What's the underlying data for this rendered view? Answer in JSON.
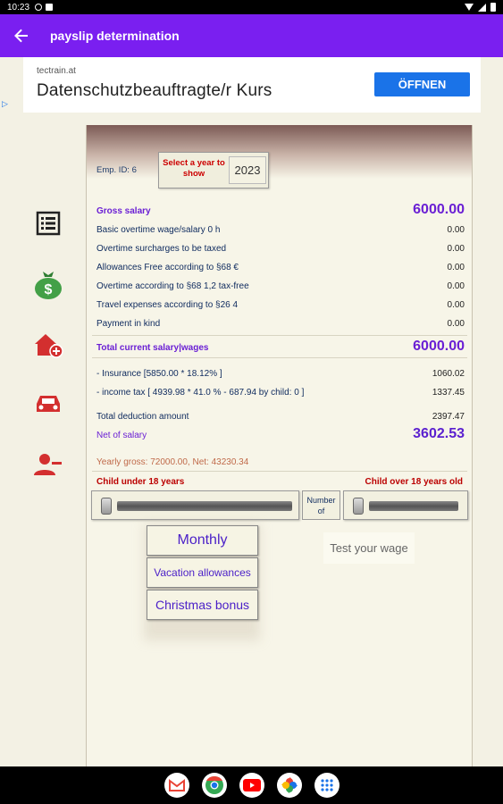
{
  "status": {
    "time": "10:23"
  },
  "app": {
    "title": "payslip determination"
  },
  "ad": {
    "source": "tectrain.at",
    "title": "Datenschutzbeauftragte/r Kurs",
    "button": "ÖFFNEN"
  },
  "sidebar": [
    {
      "name": "list-icon"
    },
    {
      "name": "money-bag-icon"
    },
    {
      "name": "house-add-icon"
    },
    {
      "name": "car-icon"
    },
    {
      "name": "person-remove-icon"
    }
  ],
  "emp": {
    "id_label": "Emp. ID: 6"
  },
  "year": {
    "label": "Select a year to show",
    "value": "2023"
  },
  "rows": {
    "gross": {
      "label": "Gross salary",
      "value": "6000.00"
    },
    "basic_overtime": {
      "label": "Basic overtime wage/salary 0 h",
      "value": "0.00"
    },
    "overtime_surcharges": {
      "label": "Overtime surcharges to be taxed",
      "value": "0.00"
    },
    "allowances": {
      "label": "Allowances Free according to §68 €",
      "value": "0.00"
    },
    "overtime_taxfree": {
      "label": "Overtime according to §68 1,2 tax-free",
      "value": "0.00"
    },
    "travel": {
      "label": "Travel expenses according to §26 4",
      "value": "0.00"
    },
    "payment_kind": {
      "label": "Payment in kind",
      "value": "0.00"
    },
    "total_current": {
      "label": "Total current salary|wages",
      "value": "6000.00"
    },
    "insurance": {
      "label": "- Insurance [5850.00 * 18.12% ]",
      "value": "1060.02"
    },
    "income_tax": {
      "label": "- income tax [ 4939.98 * 41.0 % - 687.94 by child: 0 ]",
      "value": "1337.45"
    },
    "total_deduction": {
      "label": "Total deduction amount",
      "value": "2397.47"
    },
    "net": {
      "label": "Net of salary",
      "value": "3602.53"
    }
  },
  "yearly": "Yearly gross: 72000.00, Net: 43230.34",
  "children": {
    "under": "Child under 18 years",
    "over": "Child over 18 years old",
    "number_of": "Number of"
  },
  "menu": {
    "monthly": "Monthly",
    "vacation": "Vacation allowances",
    "christmas": "Christmas bonus"
  },
  "test_button": "Test your wage",
  "navbar": [
    {
      "name": "gmail-icon",
      "color": "#ea4335"
    },
    {
      "name": "chrome-icon",
      "color": "#34a853"
    },
    {
      "name": "youtube-icon",
      "color": "#ff0000"
    },
    {
      "name": "photos-icon",
      "color": "#fbbc05"
    },
    {
      "name": "app-drawer-icon",
      "color": "#1a73e8"
    }
  ],
  "colors": {
    "appbar": "#7a1ff0",
    "accent": "#6a1fd4",
    "warning": "#bb0000"
  }
}
